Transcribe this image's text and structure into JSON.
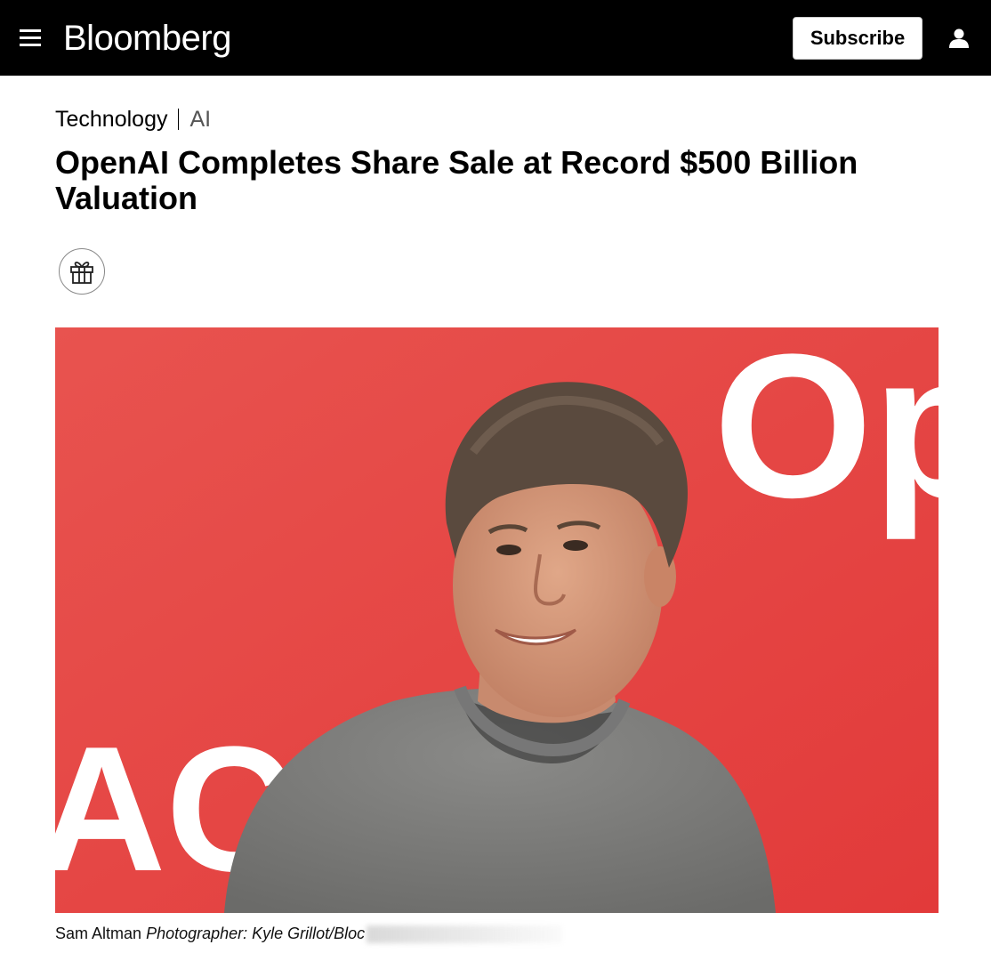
{
  "header": {
    "logo": "Bloomberg",
    "subscribe_label": "Subscribe",
    "background_color": "#000000"
  },
  "article": {
    "breadcrumb": {
      "section": "Technology",
      "subsection": "AI"
    },
    "headline": "OpenAI Completes Share Sale at Record $500 Billion Valuation",
    "gift_icon": "gift-icon",
    "image": {
      "background_color": "#e83f3f",
      "backdrop_text_right": "Op",
      "backdrop_text_left": "AC"
    },
    "caption": {
      "subject": "Sam Altman",
      "credit": "Photographer: Kyle Grillot/Bloc"
    }
  }
}
